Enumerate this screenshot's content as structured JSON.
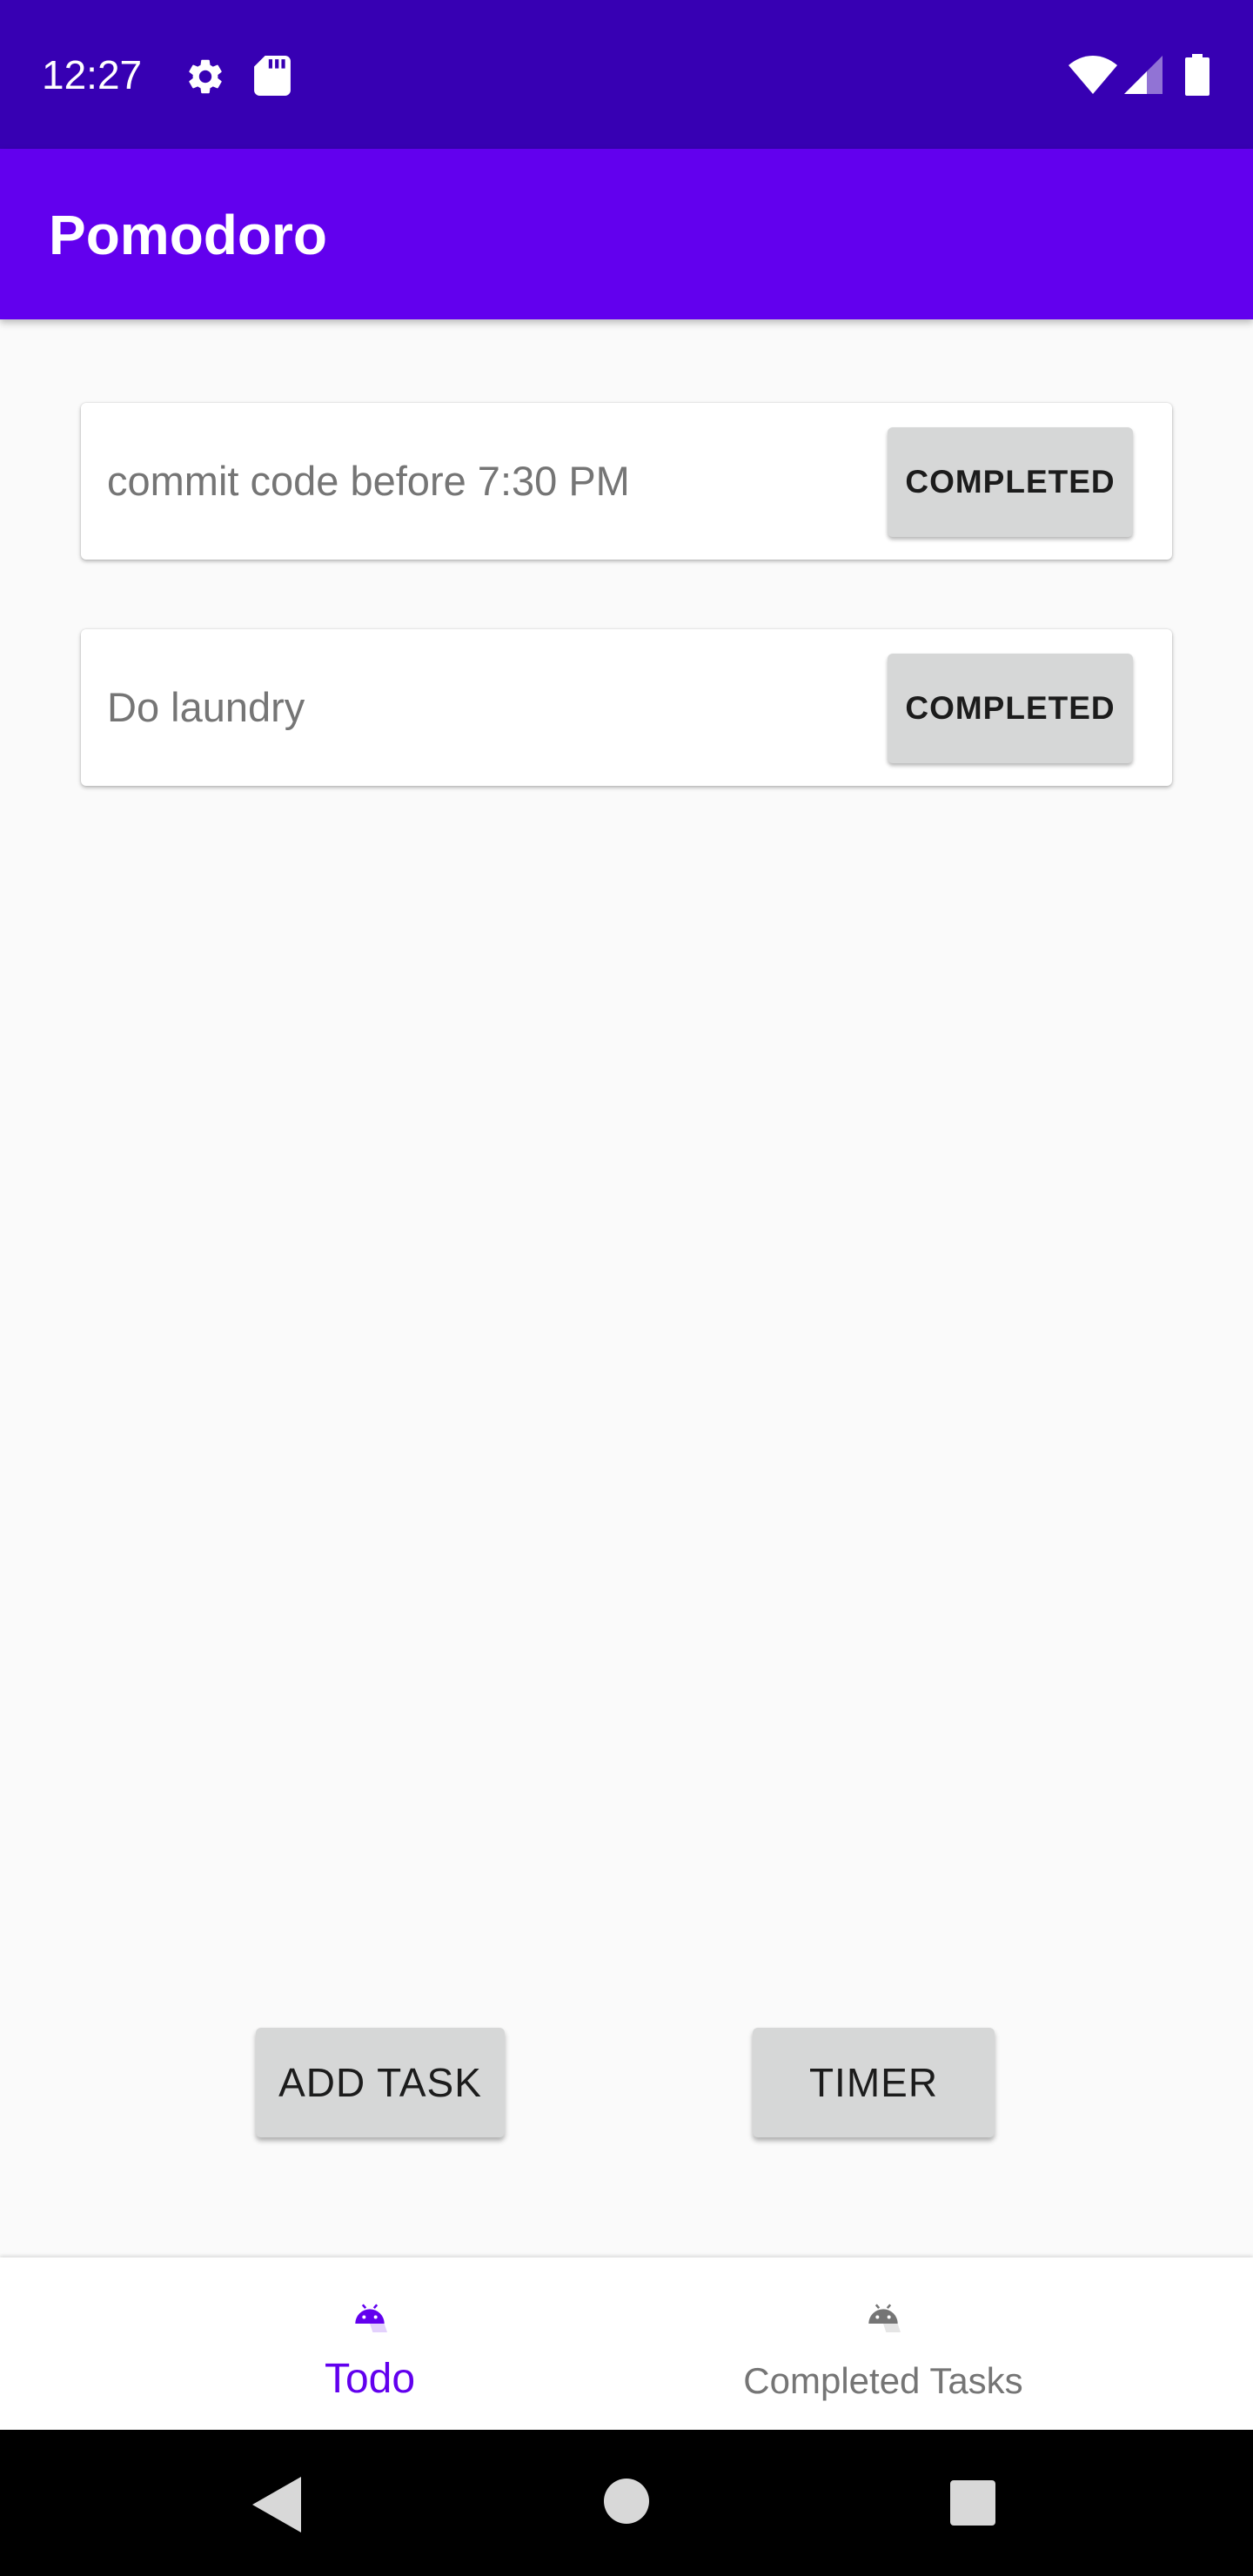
{
  "status_bar": {
    "time": "12:27",
    "icons": [
      "settings-gear-icon",
      "sd-card-icon",
      "wifi-icon",
      "cell-signal-icon",
      "battery-icon"
    ],
    "background": "#3700b3"
  },
  "app_bar": {
    "title": "Pomodoro",
    "background": "#6200ee"
  },
  "tasks": [
    {
      "text": "commit code before 7:30 PM",
      "button_label": "COMPLETED"
    },
    {
      "text": "Do laundry",
      "button_label": "COMPLETED"
    }
  ],
  "actions": {
    "add_task_label": "ADD TASK",
    "timer_label": "TIMER"
  },
  "bottom_nav": {
    "items": [
      {
        "label": "Todo",
        "icon": "android-icon",
        "selected": true,
        "color": "#6200ee"
      },
      {
        "label": "Completed Tasks",
        "icon": "android-icon",
        "selected": false,
        "color": "#757575"
      }
    ]
  },
  "system_nav": {
    "icons": [
      "back-icon",
      "home-icon",
      "recents-icon"
    ]
  }
}
